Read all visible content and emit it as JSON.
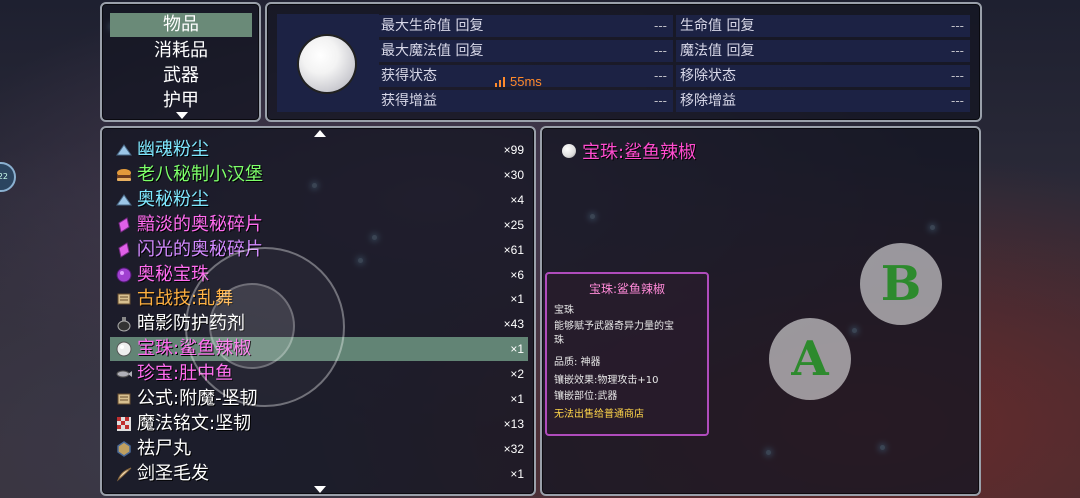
{
  "categories": {
    "items": [
      "物品",
      "消耗品",
      "武器",
      "护甲"
    ],
    "active_index": 0
  },
  "stats": {
    "rows": [
      {
        "label": "最大生命值 回复",
        "value": "---"
      },
      {
        "label": "生命值 回复",
        "value": "---"
      },
      {
        "label": "最大魔法值 回复",
        "value": "---"
      },
      {
        "label": "魔法值 回复",
        "value": "---"
      },
      {
        "label": "获得状态",
        "value": "---"
      },
      {
        "label": "移除状态",
        "value": "---"
      },
      {
        "label": "获得增益",
        "value": "---"
      },
      {
        "label": "移除增益",
        "value": "---"
      }
    ],
    "ping": "55ms"
  },
  "items": [
    {
      "name": "幽魂粉尘",
      "count": "×99",
      "color": "#7fe8ff",
      "icon": "dust-icon"
    },
    {
      "name": "老八秘制小汉堡",
      "count": "×30",
      "color": "#7dff6a",
      "icon": "burger-icon"
    },
    {
      "name": "奥秘粉尘",
      "count": "×4",
      "color": "#7fe8ff",
      "icon": "dust-icon"
    },
    {
      "name": "黯淡的奥秘碎片",
      "count": "×25",
      "color": "#ff6cf0",
      "icon": "shard-icon"
    },
    {
      "name": "闪光的奥秘碎片",
      "count": "×61",
      "color": "#d28aff",
      "icon": "shard-icon"
    },
    {
      "name": "奥秘宝珠",
      "count": "×6",
      "color": "#ff6cf0",
      "icon": "orb-icon"
    },
    {
      "name": "古战技:乱舞",
      "count": "×1",
      "color": "#ffb040",
      "icon": "scroll-icon"
    },
    {
      "name": "暗影防护药剂",
      "count": "×43",
      "color": "#ffffff",
      "icon": "potion-icon"
    },
    {
      "name": "宝珠:鲨鱼辣椒",
      "count": "×1",
      "color": "#ff6cf0",
      "icon": "pearl-icon"
    },
    {
      "name": "珍宝:肚中鱼",
      "count": "×2",
      "color": "#ff6cf0",
      "icon": "fish-icon"
    },
    {
      "name": "公式:附魔-坚韧",
      "count": "×1",
      "color": "#ffffff",
      "icon": "scroll-icon"
    },
    {
      "name": "魔法铭文:坚韧",
      "count": "×13",
      "color": "#ffffff",
      "icon": "inscription-icon"
    },
    {
      "name": "祛尸丸",
      "count": "×32",
      "color": "#ffffff",
      "icon": "pill-icon"
    },
    {
      "name": "剑圣毛发",
      "count": "×1",
      "color": "#ffffff",
      "icon": "hair-icon"
    }
  ],
  "selected_index": 8,
  "detail": {
    "title": "宝珠:鲨鱼辣椒",
    "tooltip": {
      "title": "宝珠:鲨鱼辣椒",
      "type": "宝珠",
      "desc_1": "能够赋予武器奇异力量的宝",
      "desc_2": "珠",
      "quality": "品质: 神器",
      "effect": "镶嵌效果:物理攻击+10",
      "slot": "镶嵌部位:武器",
      "note": "无法出售给普通商店"
    }
  },
  "controls": {
    "a_label": "A",
    "b_label": "B",
    "side_badge": "22"
  }
}
